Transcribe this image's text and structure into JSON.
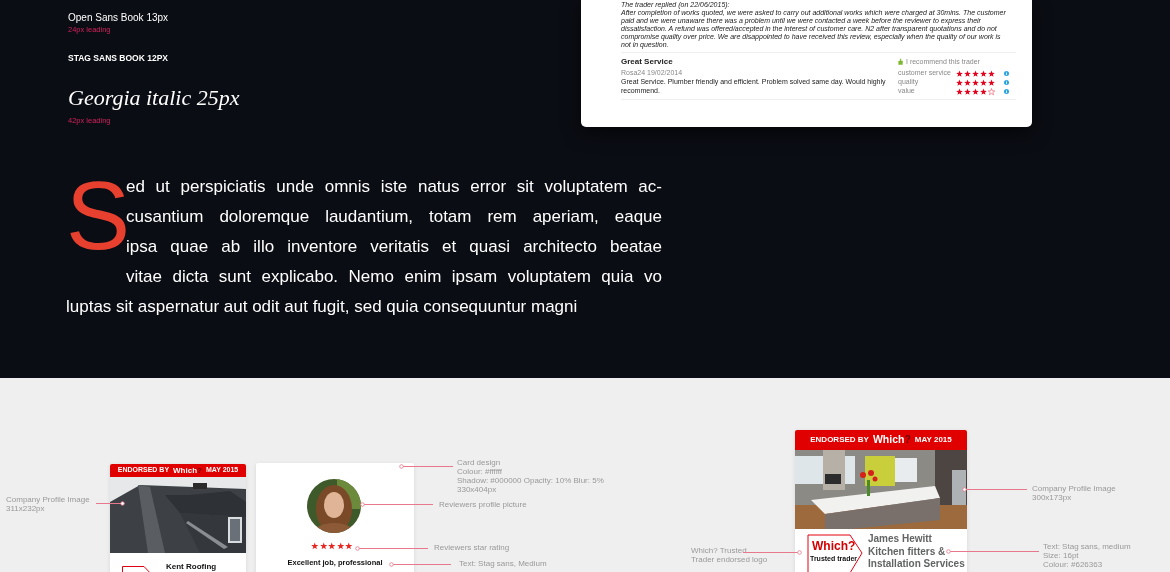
{
  "type_samples": [
    {
      "kind": "sans",
      "text": "Open Sans Book 13px"
    },
    {
      "kind": "note",
      "text": "24px leading"
    },
    {
      "kind": "caps",
      "text": "STAG SANS BOOK 12PX"
    },
    {
      "kind": "serif",
      "text": "Georgia italic 25px"
    },
    {
      "kind": "note",
      "text": "42px leading"
    }
  ],
  "drop_cap_paragraph": {
    "initial": "S",
    "lines": [
      "ed ut perspiciatis unde omnis iste natus error sit voluptatem ac-",
      "cusantium doloremque laudantium, totam rem aperiam, eaque",
      "ipsa quae ab illo inventore veritatis et quasi architecto beatae",
      "vitae dicta sunt explicabo. Nemo enim ipsam voluptatem quia vo",
      "luptas sit aspernatur aut odit aut fugit, sed quia consequuntur magni"
    ]
  },
  "review_panel": {
    "reply_heading": "The trader replied (on 22/06/2015):",
    "reply_text": "After completion of works quoted, we were asked to carry out additional works which were charged at 30mins. The customer paid and we were unaware there was a problem until we were contacted a week before the reviewer to express their dissatisfaction. A refund was offered/accepted in the interest of customer care. N2 after transparent quotations and do not compromise quality over price. We are disappointed to have received this review, especially when the quality of our work is not in question.",
    "review": {
      "title": "Great Service",
      "author": "Rosa24",
      "date": "19/02/2014",
      "body": "Great Service. Plumber friendly and efficient. Problem solved same day. Would highly recommend.",
      "recommendation": "I recommend this trader",
      "ratings": [
        {
          "label": "customer service",
          "stars": 5
        },
        {
          "label": "quality",
          "stars": 5
        },
        {
          "label": "value",
          "stars": 4
        }
      ]
    }
  },
  "cards": [
    {
      "kind": "company",
      "banner": {
        "prefix": "ENDORSED BY",
        "brand": "Which",
        "brand_mark": "?",
        "suffix": "MAY 2015"
      },
      "name_lines": [
        "Kent Roofing"
      ]
    },
    {
      "kind": "review",
      "stars": 5,
      "title": "Excellent job, professional"
    },
    {
      "kind": "company",
      "banner": {
        "prefix": "ENDORSED BY",
        "brand": "Which",
        "brand_mark": "?",
        "suffix": "MAY 2015"
      },
      "logo": {
        "brand": "Which",
        "mark": "?",
        "tagline": "Trusted trader"
      },
      "name_lines": [
        "James Hewitt",
        "Kitchen fitters &",
        "Installation Services"
      ]
    }
  ],
  "annotations": [
    {
      "lines": [
        "Company Profile Image",
        "311x232px"
      ]
    },
    {
      "lines": [
        "Card design",
        "Colour: #ffffff",
        "Shadow: #000000  Opacity: 10% Blur: 5%",
        "330x404px"
      ]
    },
    {
      "lines": [
        "Reviewers profile picture"
      ]
    },
    {
      "lines": [
        "Reviewers star rating"
      ]
    },
    {
      "lines": [
        "Text:  Stag sans, Medium"
      ]
    },
    {
      "lines": [
        "Company Profile Image",
        "300x173px"
      ]
    },
    {
      "lines": [
        "Which? Trusted",
        "Trader endorsed logo"
      ]
    },
    {
      "lines": [
        "Text:  Stag sans, medium",
        "Size: 16pt",
        "Colour: #626363"
      ]
    }
  ]
}
